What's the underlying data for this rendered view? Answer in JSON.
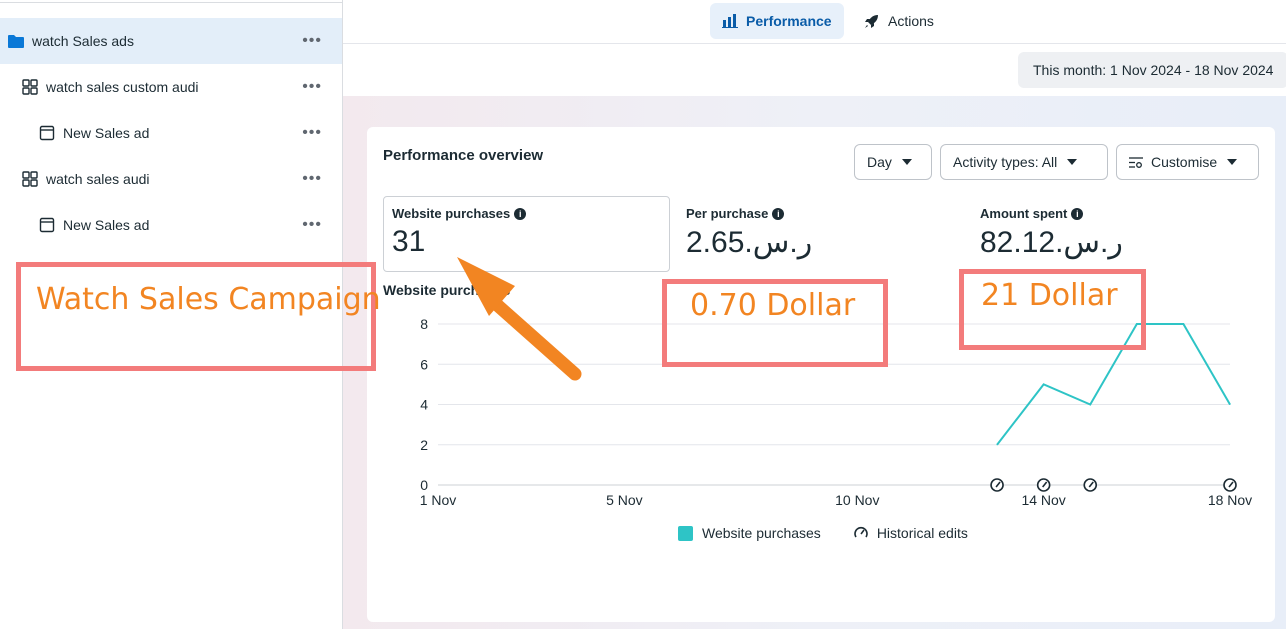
{
  "sidebar": {
    "items": [
      {
        "label": "watch Sales ads",
        "icon": "folder-icon"
      },
      {
        "label": "watch sales custom audi",
        "icon": "adset-grid-icon"
      },
      {
        "label": "New Sales ad",
        "icon": "ad-window-icon"
      },
      {
        "label": "watch sales audi",
        "icon": "adset-grid-icon"
      },
      {
        "label": "New Sales ad",
        "icon": "ad-window-icon"
      }
    ],
    "more_label": "•••"
  },
  "tabs": [
    {
      "label": "Performance",
      "icon": "bar-chart-icon",
      "active": true
    },
    {
      "label": "Actions",
      "icon": "rocket-icon",
      "active": false
    }
  ],
  "date_range": "This month: 1 Nov 2024 - 18 Nov 2024",
  "card": {
    "title": "Performance overview",
    "controls": {
      "day": "Day",
      "activity": "Activity types: All",
      "customise": "Customise"
    },
    "metrics": [
      {
        "label": "Website purchases",
        "value": "31"
      },
      {
        "label": "Per purchase",
        "value": "2.65.ر.س"
      },
      {
        "label": "Amount spent",
        "value": "82.12.ر.س"
      }
    ],
    "chart_label": "Website purchases",
    "legend": {
      "series": "Website purchases",
      "edits": "Historical edits"
    }
  },
  "colors": {
    "accent": "#0a5ca8",
    "series": "#2ec4c6",
    "annotation_border": "#f37b7b",
    "annotation_text": "#f28522",
    "selected_row": "#e3eef9"
  },
  "chart_data": {
    "type": "line",
    "x_ticks": [
      "1 Nov",
      "5 Nov",
      "10 Nov",
      "14 Nov",
      "18 Nov"
    ],
    "y_ticks": [
      "0",
      "2",
      "4",
      "6",
      "8"
    ],
    "ylim": [
      0,
      8
    ],
    "xlim": [
      1,
      18
    ],
    "series": [
      {
        "name": "Website purchases",
        "x": [
          13,
          14,
          15,
          16,
          17,
          18
        ],
        "values": [
          2,
          5,
          4,
          8,
          8,
          4
        ]
      }
    ],
    "historical_edits_x": [
      13,
      14,
      15,
      18
    ],
    "grid": true
  },
  "annotations": {
    "campaign": "Watch Sales Campaign",
    "per_purchase": "0.70 Dollar",
    "amount": "21 Dollar"
  }
}
